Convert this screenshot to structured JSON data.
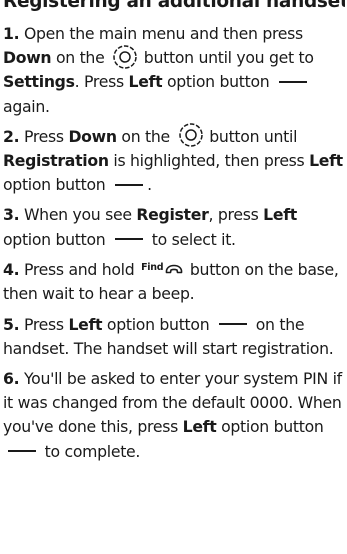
{
  "title": "Registering an additional handset",
  "steps": [
    {
      "num": "1.",
      "t1": "Open the main menu and then press ",
      "t2": "Down",
      "t3": " on the ",
      "t4": " button until you get to ",
      "t5": "Settings",
      "t6": ". Press ",
      "t7": "Left",
      "t8": " option button ",
      "t9": " again."
    },
    {
      "num": "2.",
      "t1": "Press ",
      "t2": "Down",
      "t3": " on the ",
      "t4": " button until ",
      "t5": "Registration",
      "t6": " is highlighted, then press ",
      "t7": "Left",
      "t8": " option button ",
      "t9": "."
    },
    {
      "num": "3.",
      "t1": "When you see ",
      "t2": "Register",
      "t3": ", press ",
      "t4": "Left",
      "t5": " option button ",
      "t6": " to select it."
    },
    {
      "num": "4.",
      "t1": "Press and hold ",
      "find": "Find",
      "t2": " button on the base, then wait to hear a beep."
    },
    {
      "num": "5.",
      "t1": "Press ",
      "t2": "Left",
      "t3": " option button ",
      "t4": " on the handset. The handset will start registration."
    },
    {
      "num": "6.",
      "t1": "You'll be asked to enter your system PIN if it was changed from the default 0000. When you've done this, press ",
      "t2": "Left",
      "t3": " option button ",
      "t4": " to complete."
    }
  ],
  "icons": {
    "nav": "navigation-button-icon",
    "dash": "left-option-button-icon",
    "handset": "handset-icon"
  }
}
